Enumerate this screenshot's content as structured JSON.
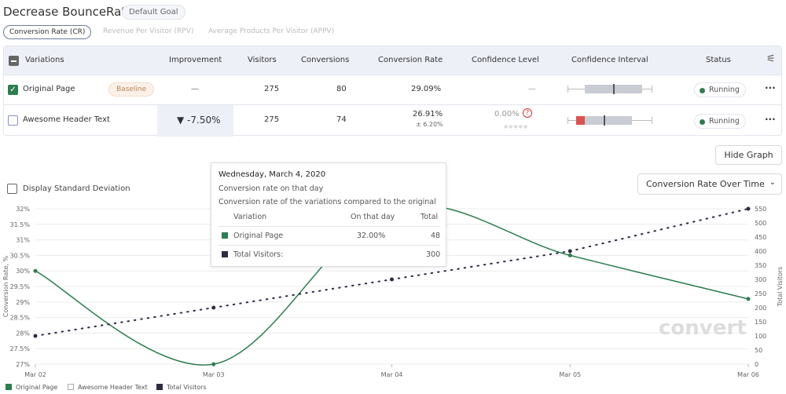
{
  "header": {
    "title": "Decrease BounceRate",
    "goal_badge": "Default Goal"
  },
  "metric_tabs": [
    {
      "label": "Conversion Rate (CR)",
      "active": true
    },
    {
      "label": "Revenue Per Visitor (RPV)",
      "active": false
    },
    {
      "label": "Average Products Per Visitor (APPV)",
      "active": false
    }
  ],
  "table": {
    "columns": [
      "Variations",
      "Improvement",
      "Visitors",
      "Conversions",
      "Conversion Rate",
      "Confidence Level",
      "Confidence Interval",
      "Status"
    ],
    "rows": [
      {
        "name": "Original Page",
        "checked": true,
        "badge": "Baseline",
        "improvement": "—",
        "visitors": "275",
        "conversions": "80",
        "conversion_rate": "29.09%",
        "cr_margin": "",
        "confidence": "—",
        "status": "Running"
      },
      {
        "name": "Awesome Header Text",
        "checked": false,
        "badge": "",
        "improvement": "▼ -7.50%",
        "visitors": "275",
        "conversions": "74",
        "conversion_rate": "26.91%",
        "cr_margin": "± 6.20%",
        "confidence": "0.00%",
        "status": "Running"
      }
    ]
  },
  "controls": {
    "hide_graph": "Hide Graph",
    "std_dev_label": "Display Standard Deviation",
    "chart_select": "Conversion Rate Over Time"
  },
  "tooltip": {
    "date": "Wednesday, March 4, 2020",
    "line1": "Conversion rate on that day",
    "line2": "Conversion rate of the variations compared to the original",
    "col_variation": "Variation",
    "col_day": "On that day",
    "col_total": "Total",
    "row1_name": "Original Page",
    "row1_day": "32.00%",
    "row1_total": "48",
    "row2_name": "Total Visitors:",
    "row2_total": "300"
  },
  "colors": {
    "original": "#2e7d4f",
    "visitors": "#2c2c44",
    "accent": "#6a7aa0",
    "negative": "#d9534f"
  },
  "chart_data": {
    "type": "line",
    "x": [
      "Mar 02",
      "Mar 03",
      "Mar 04",
      "Mar 05",
      "Mar 06"
    ],
    "ylabel": "Conversion Rate, %",
    "y2label": "Total Visitors",
    "ylim": [
      27,
      32
    ],
    "y2lim": [
      0,
      550
    ],
    "yticks": [
      "27%",
      "27.5%",
      "28%",
      "28.5%",
      "29%",
      "29.5%",
      "30%",
      "30.5%",
      "31%",
      "31.5%",
      "32%"
    ],
    "y2ticks": [
      "0",
      "50",
      "100",
      "150",
      "200",
      "250",
      "300",
      "350",
      "400",
      "450",
      "500",
      "550"
    ],
    "series": [
      {
        "name": "Original Page",
        "axis": "left",
        "values": [
          30,
          27,
          32,
          30.5,
          29.1
        ]
      },
      {
        "name": "Awesome Header Text",
        "axis": "left",
        "values": []
      },
      {
        "name": "Total Visitors",
        "axis": "right",
        "values": [
          100,
          200,
          300,
          400,
          550
        ]
      }
    ],
    "grid": true,
    "legend": "bottom-left",
    "watermark": "convert"
  }
}
